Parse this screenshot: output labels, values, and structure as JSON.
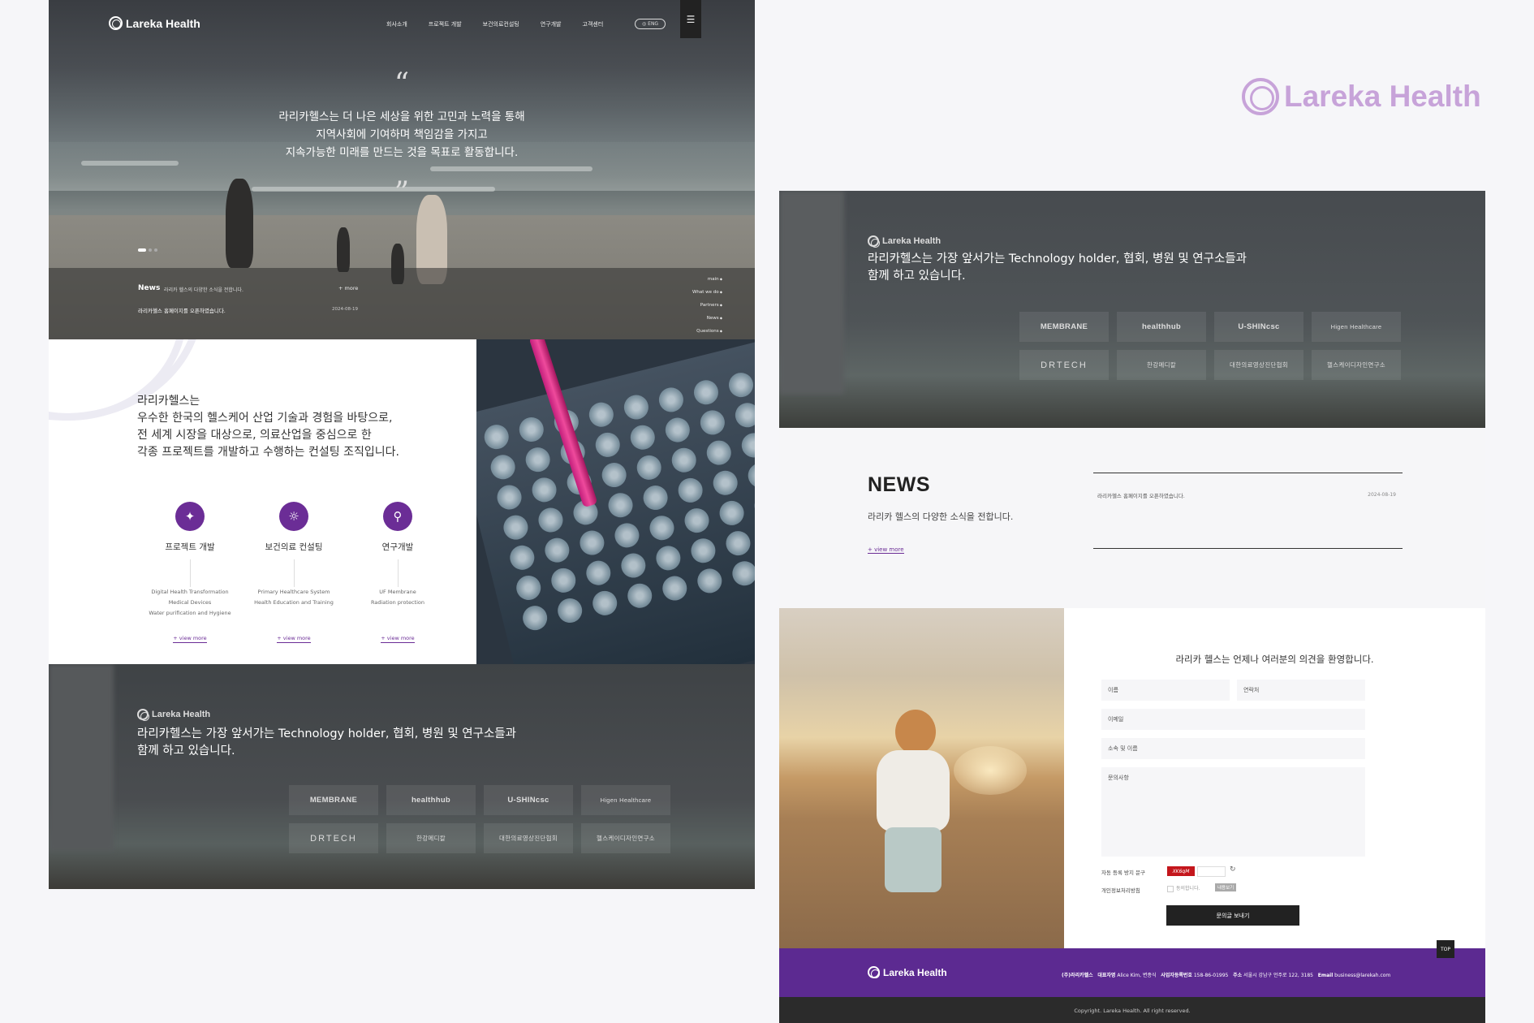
{
  "brand": {
    "name": "Lareka Health",
    "accent": "#6b2d96",
    "footer_color": "#5c2a91",
    "logo_tint": "#c7a3d9"
  },
  "nav": {
    "items": [
      "회사소개",
      "프로젝트 개발",
      "보건의료컨설팅",
      "연구개발",
      "고객센터"
    ],
    "lang": "ENG",
    "menu_icon": "hamburger-icon"
  },
  "hero": {
    "quote_open": "“",
    "quote_close": "”",
    "lines": [
      "라리카헬스는 더 나은 세상을 위한 고민과 노력을 통해",
      "지역사회에 기여하며 책임감을 가지고",
      "지속가능한 미래를 만드는 것을 목표로 활동합니다."
    ],
    "news_label": "News",
    "news_desc": "라리카 헬스의 다양한 소식을 전합니다.",
    "more": "+ more",
    "news_item": "라리카헬스 홈페이지를 오픈하였습니다.",
    "news_date": "2024-08-19",
    "side_nav": [
      "main",
      "What we do",
      "Partners",
      "News",
      "Questions"
    ]
  },
  "about": {
    "intro": [
      "라리카헬스는",
      "우수한 한국의 헬스케어 산업 기술과 경험을 바탕으로,",
      "전 세계 시장을 대상으로, 의료산업을 중심으로 한",
      "각종 프로젝트를 개발하고 수행하는 컨설팅 조직입니다."
    ],
    "services": [
      {
        "icon": "hands-care-icon",
        "title": "프로젝트 개발",
        "sub": [
          "Digital Health Transformation",
          "Medical Devices",
          "Water purification and Hygiene"
        ],
        "link": "+ view more"
      },
      {
        "icon": "lightbulb-icon",
        "title": "보건의료 컨설팅",
        "sub": [
          "Primary Healthcare System",
          "Health Education and Training"
        ],
        "link": "+ view more"
      },
      {
        "icon": "research-icon",
        "title": "연구개발",
        "sub": [
          "UF Membrane",
          "Radiation protection"
        ],
        "link": "+ view more"
      }
    ]
  },
  "partners": {
    "logo": "Lareka Health",
    "text": [
      "라리카헬스는 가장 앞서가는 Technology holder, 협회, 병원 및 연구소들과",
      "함께 하고 있습니다."
    ],
    "items": [
      "MEMBRANE",
      "healthhub",
      "U-SHINcsc",
      "Higen Healthcare",
      "DRTECH",
      "한강메디칼",
      "대한의료영상진단협회",
      "헬스케이디자인연구소"
    ]
  },
  "news": {
    "title": "NEWS",
    "sub": "라리카 헬스의 다양한 소식을 전합니다.",
    "link": "+ view more",
    "item": "라리카헬스 홈페이지를 오픈하였습니다.",
    "date": "2024-08-19"
  },
  "contact": {
    "title": "라리카 헬스는 언제나 여러분의 의견을 환영합니다.",
    "name": "이름",
    "phone": "연락처",
    "email": "이메일",
    "org": "소속 및 이름",
    "message": "문의사항",
    "captcha_label": "자동 등록 방지 문구",
    "captcha_code": "XK6qM",
    "privacy_label": "개인정보처리방침",
    "agree": "동의합니다.",
    "view": "내용보기",
    "submit": "문의글 보내기"
  },
  "footer": {
    "logo": "Lareka Health",
    "company": "(주)라리카헬스",
    "ceo_label": "대표자명",
    "ceo": "Alice Kim, 변종식",
    "biz_label": "사업자등록번호",
    "biz": "158-86-01995",
    "addr_label": "주소",
    "addr": "서울시 강남구 언주로 122, 3185",
    "email_label": "Email",
    "email": "business@larekah.com",
    "top": "TOP",
    "copyright": "Copyright. Lareka Health. All right reserved."
  }
}
